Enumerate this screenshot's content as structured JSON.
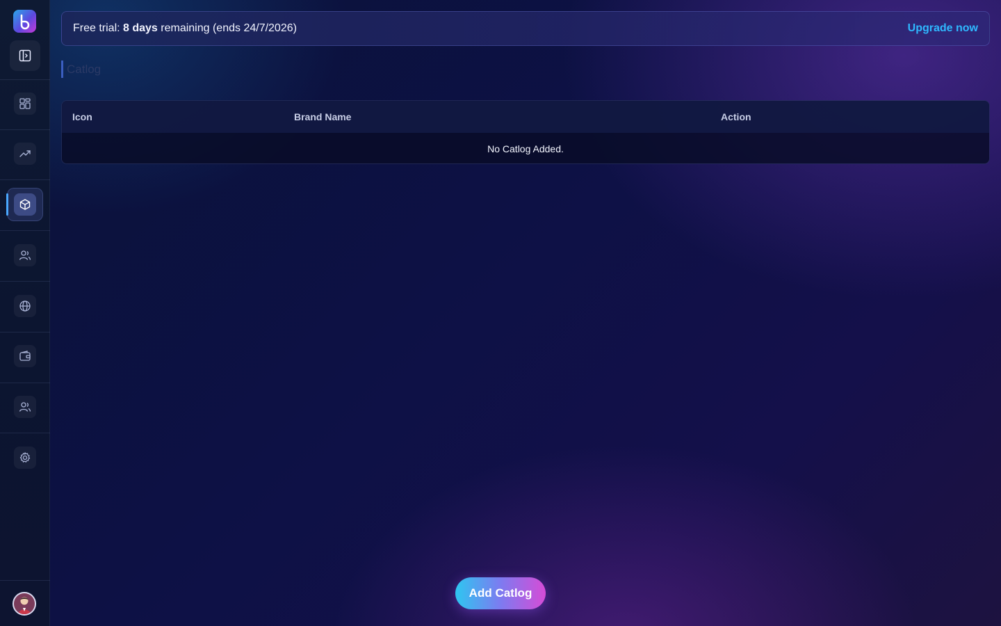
{
  "banner": {
    "prefix": "Free trial: ",
    "days": "8 days",
    "suffix": " remaining (ends 24/7/2026)",
    "cta": "Upgrade now"
  },
  "page": {
    "title": "Catlog"
  },
  "table": {
    "columns": [
      "Icon",
      "Brand Name",
      "Action"
    ],
    "empty_message": "No Catlog Added."
  },
  "actions": {
    "add_label": "Add Catlog"
  },
  "sidebar": {
    "items": [
      {
        "icon": "dashboard-icon"
      },
      {
        "icon": "trending-up-icon"
      },
      {
        "icon": "box-icon",
        "active": true
      },
      {
        "icon": "users-icon"
      },
      {
        "icon": "globe-icon"
      },
      {
        "icon": "wallet-icon"
      },
      {
        "icon": "team-icon"
      },
      {
        "icon": "settings-icon"
      }
    ]
  },
  "colors": {
    "accent": "#2fb8ff",
    "active_indicator": "#4aa8ff"
  }
}
